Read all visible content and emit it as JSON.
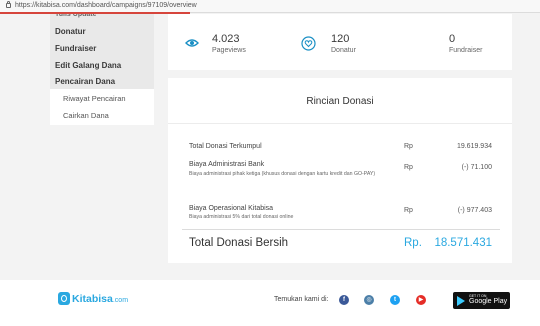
{
  "browser": {
    "url": "https://kitabisa.com/dashboard/campaigns/97109/overview"
  },
  "sidebar": {
    "cut_item": "Tulis Update",
    "items": [
      {
        "label": "Donatur"
      },
      {
        "label": "Fundraiser"
      },
      {
        "label": "Edit Galang Dana"
      },
      {
        "label": "Pencairan Dana"
      }
    ],
    "sub_items": [
      {
        "label": "Riwayat Pencairan"
      },
      {
        "label": "Cairkan Dana"
      }
    ]
  },
  "stats": [
    {
      "icon": "eye-icon",
      "value": "4.023",
      "label": "Pageviews"
    },
    {
      "icon": "heart-icon",
      "value": "120",
      "label": "Donatur"
    },
    {
      "icon": "none",
      "value": "0",
      "label": "Fundraiser"
    }
  ],
  "rincian": {
    "title": "Rincian Donasi",
    "rows": [
      {
        "label": "Total Donasi Terkumpul",
        "note": "",
        "currency": "Rp",
        "amount": "19.619.934"
      },
      {
        "label": "Biaya Administrasi Bank",
        "note": "Biaya administrasi pihak ketiga (khusus donasi dengan kartu kredit dan GO-PAY)",
        "currency": "Rp",
        "amount": "(-) 71.100"
      },
      {
        "label": "Biaya Operasional Kitabisa",
        "note": "Biaya administrasi 5% dari total donasi online",
        "currency": "Rp",
        "amount": "(-) 977.403"
      }
    ],
    "total": {
      "label": "Total Donasi Bersih",
      "currency": "Rp.",
      "amount": "18.571.431"
    }
  },
  "footer": {
    "logo_main": "Kitabisa",
    "logo_suffix": ".com",
    "follow_text": "Temukan kami di:",
    "socials": [
      {
        "name": "facebook-icon",
        "glyph": "f",
        "color": "#3b5998"
      },
      {
        "name": "instagram-icon",
        "glyph": "◎",
        "color": "#4c7fa8"
      },
      {
        "name": "twitter-icon",
        "glyph": "t",
        "color": "#1da1f2"
      },
      {
        "name": "youtube-icon",
        "glyph": "▶",
        "color": "#e52d27"
      }
    ],
    "gplay_small": "GET IT ON",
    "gplay_big": "Google Play"
  },
  "colors": {
    "accent": "#2aa8e0"
  }
}
